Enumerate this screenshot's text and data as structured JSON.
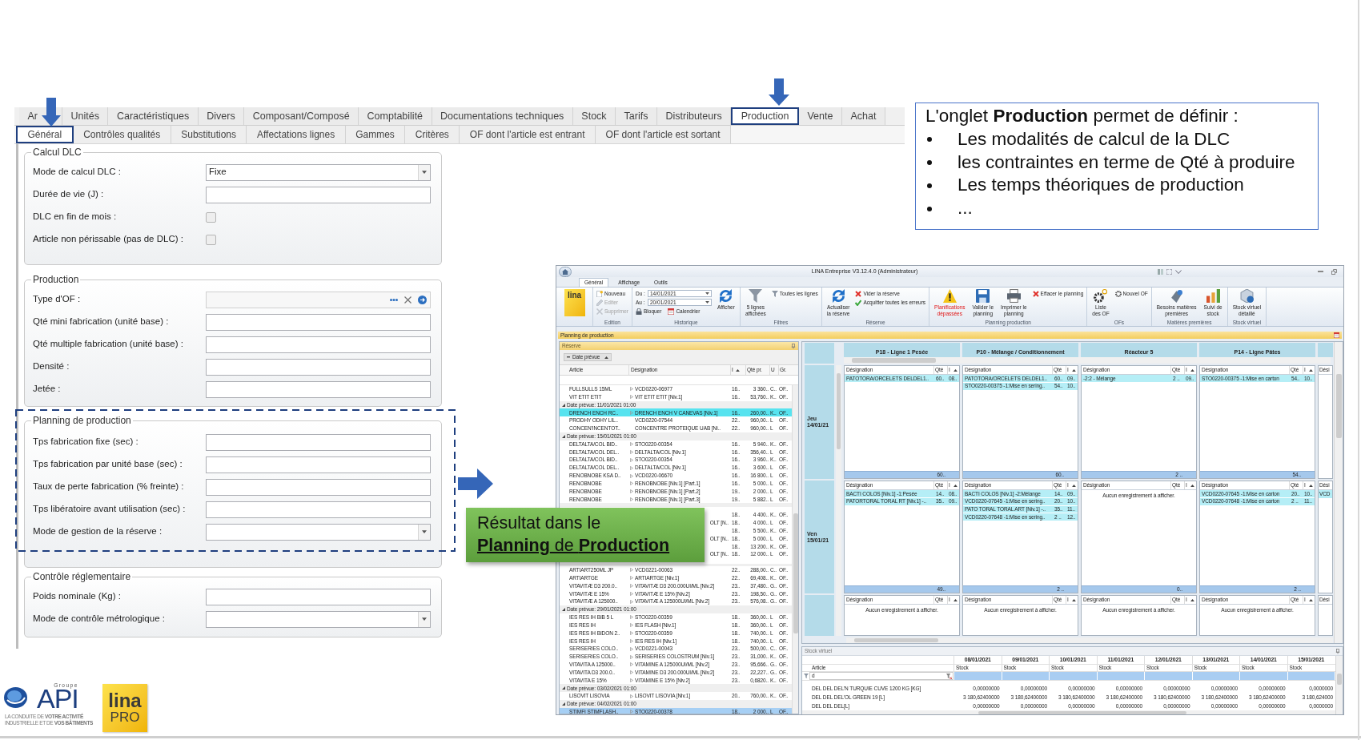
{
  "form": {
    "tabs": [
      {
        "label": "Ar",
        "selected": false
      },
      {
        "label": "Unités",
        "selected": false
      },
      {
        "label": "Caractéristiques",
        "selected": false
      },
      {
        "label": "Divers",
        "selected": false
      },
      {
        "label": "Composant/Composé",
        "selected": false
      },
      {
        "label": "Comptabilité",
        "selected": false
      },
      {
        "label": "Documentations techniques",
        "selected": false
      },
      {
        "label": "Stock",
        "selected": false
      },
      {
        "label": "Tarifs",
        "selected": false
      },
      {
        "label": "Distributeurs",
        "selected": false
      },
      {
        "label": "Production",
        "selected": true
      },
      {
        "label": "Vente",
        "selected": false
      },
      {
        "label": "Achat",
        "selected": false
      }
    ],
    "subtabs": [
      {
        "label": "Général",
        "selected": true
      },
      {
        "label": "Contrôles qualités",
        "selected": false
      },
      {
        "label": "Substitutions",
        "selected": false
      },
      {
        "label": "Affectations lignes",
        "selected": false
      },
      {
        "label": "Gammes",
        "selected": false
      },
      {
        "label": "Critères",
        "selected": false
      },
      {
        "label": "OF dont l'article est entrant",
        "selected": false
      },
      {
        "label": "OF dont l'article est sortant",
        "selected": false
      }
    ],
    "groups": [
      {
        "title": "Calcul DLC",
        "highlighted": false,
        "fields": [
          {
            "kind": "select",
            "label": "Mode de calcul DLC :",
            "value": "Fixe"
          },
          {
            "kind": "text",
            "label": "Durée de vie (J) :"
          },
          {
            "kind": "checkbox",
            "label": "DLC en fin de mois :",
            "checked": false
          },
          {
            "kind": "checkbox",
            "label": "Article non périssable (pas de DLC) :",
            "checked": false
          }
        ]
      },
      {
        "title": "Production",
        "highlighted": false,
        "fields": [
          {
            "kind": "lookup",
            "label": "Type d'OF :"
          },
          {
            "kind": "text",
            "label": "Qté mini fabrication (unité base) :"
          },
          {
            "kind": "text",
            "label": "Qté multiple fabrication (unité base) :"
          },
          {
            "kind": "text",
            "label": "Densité :"
          },
          {
            "kind": "text",
            "label": "Jetée :"
          }
        ]
      },
      {
        "title": "Planning de production",
        "highlighted": true,
        "fields": [
          {
            "kind": "text",
            "label": "Tps fabrication fixe (sec) :"
          },
          {
            "kind": "text",
            "label": "Tps fabrication par unité base (sec) :"
          },
          {
            "kind": "text",
            "label": "Taux de perte fabrication (% freinte) :"
          },
          {
            "kind": "text",
            "label": "Tps libératoire avant utilisation (sec) :"
          },
          {
            "kind": "select",
            "label": "Mode de gestion de la réserve :"
          }
        ]
      },
      {
        "title": "Contrôle réglementaire",
        "highlighted": false,
        "fields": [
          {
            "kind": "text",
            "label": "Poids nominale (Kg) :"
          },
          {
            "kind": "select",
            "label": "Mode de contrôle métrologique :"
          }
        ]
      }
    ]
  },
  "note": {
    "title": "L'onglet **Production** permet de définir :",
    "bullets": [
      "Les modalités de calcul de la DLC",
      "les contraintes en terme de Qté à produire",
      "Les temps théoriques de production",
      "..."
    ]
  },
  "callout": {
    "lead": "Résultat dans le",
    "emphasis": "**Planning** de **Production**"
  },
  "app": {
    "title": "LINA Entreprise V3.12.4.0 (Administrateur)",
    "ribbon_tabs": [
      {
        "label": "Général",
        "selected": true
      },
      {
        "label": "Affichage",
        "selected": false
      },
      {
        "label": "Outils",
        "selected": false
      }
    ],
    "ribbon_logo": "lina",
    "ribbon": [
      {
        "label": "Edition",
        "buttons": [
          {
            "kind": "small",
            "label": "Nouveau",
            "disabled": false
          },
          {
            "kind": "small",
            "label": "Editer",
            "disabled": true
          },
          {
            "kind": "small",
            "label": "Supprimer",
            "disabled": true
          }
        ]
      },
      {
        "label": "Historique",
        "buttons": [
          {
            "kind": "date",
            "label": "Du :",
            "value": "14/01/2021"
          },
          {
            "kind": "date",
            "label": "Au :",
            "value": "20/01/2021"
          },
          {
            "kind": "pair",
            "buttons": [
              {
                "kind": "small",
                "label": "Bloquer",
                "disabled": false
              },
              {
                "kind": "small",
                "label": "Calendrier",
                "disabled": false
              }
            ]
          },
          {
            "kind": "large",
            "label": "Afficher",
            "alert": false
          }
        ]
      },
      {
        "label": "Filtres",
        "buttons": [
          {
            "kind": "large",
            "label": "5 lignes\naffichées",
            "alert": false
          },
          {
            "kind": "small",
            "label": "Toutes les lignes",
            "disabled": false
          }
        ]
      },
      {
        "label": "Réserve",
        "buttons": [
          {
            "kind": "large",
            "label": "Actualiser\nla réserve",
            "alert": false
          },
          {
            "kind": "small",
            "label": "Vider la réserve",
            "disabled": false
          },
          {
            "kind": "small",
            "label": "Acquitter toutes les erreurs",
            "disabled": false
          }
        ]
      },
      {
        "label": "Planning production",
        "buttons": [
          {
            "kind": "large",
            "label": "Planifications\ndépassées",
            "alert": true
          },
          {
            "kind": "large",
            "label": "Valider le\nplanning",
            "alert": false
          },
          {
            "kind": "large",
            "label": "Imprimer le\nplanning",
            "alert": false
          },
          {
            "kind": "small",
            "label": "Effacer le planning",
            "disabled": false
          }
        ]
      },
      {
        "label": "OFs",
        "buttons": [
          {
            "kind": "large",
            "label": "Liste\ndes OF",
            "alert": false
          },
          {
            "kind": "small",
            "label": "Nouvel OF",
            "disabled": false
          }
        ]
      },
      {
        "label": "Matières premières",
        "buttons": [
          {
            "kind": "large",
            "label": "Besoins matières\npremières",
            "alert": false
          },
          {
            "kind": "large",
            "label": "Suivi de\nstock",
            "alert": false
          }
        ]
      },
      {
        "label": "Stock virtuel",
        "buttons": [
          {
            "kind": "large",
            "label": "Stock virtuel\ndétaillé",
            "alert": false
          }
        ]
      }
    ],
    "panel_title": "Planning de production",
    "reserve": {
      "title": "Réserve",
      "group_chip": "Date prévue",
      "columns": [
        "Article",
        "Désignation",
        "I",
        "Qté pr.",
        "U",
        "Gr."
      ],
      "rows": [
        {
          "kind": "row",
          "marked": true,
          "selected": false,
          "cells": [
            "FULLSULLS 15ML",
            "VCD0220-06977",
            "16..",
            "3 360..",
            "C..",
            "OF.."
          ]
        },
        {
          "kind": "row",
          "marked": true,
          "selected": false,
          "cells": [
            "VIT ETIT ETIT",
            "VIT ETIT ETIT [Niv.1]",
            "16..",
            "53,760..",
            "K..",
            "OF.."
          ]
        },
        {
          "kind": "group",
          "expanded": true,
          "label": "Date prévue: 11/01/2021 01:00"
        },
        {
          "kind": "row",
          "marked": true,
          "selected": true,
          "color": "#57e3ef",
          "cells": [
            "DRENCH ENCH RC..",
            "DRENCH ENCH V CANEVAS [Niv.1]",
            "16..",
            "260,00..",
            "K..",
            "OF.."
          ]
        },
        {
          "kind": "row",
          "marked": false,
          "selected": false,
          "cells": [
            "PRODHY ODHY LIL..",
            "VCD0220-07544",
            "22..",
            "960,00..",
            "L",
            "OF.."
          ]
        },
        {
          "kind": "row",
          "marked": false,
          "selected": false,
          "cells": [
            "CONCEN'INCENTOT..",
            "CONCENTRE PROTEIQUE UAB [Ni..",
            "22..",
            "960,00..",
            "L",
            "OF.."
          ]
        },
        {
          "kind": "group",
          "expanded": true,
          "label": "Date prévue: 15/01/2021 01:00"
        },
        {
          "kind": "row",
          "marked": true,
          "selected": false,
          "cells": [
            "DELTALTA/COL BID..",
            "STO0220-00354",
            "16..",
            "5 940..",
            "K..",
            "OF.."
          ]
        },
        {
          "kind": "row",
          "marked": true,
          "selected": false,
          "cells": [
            "DELTALTA/COL DEL..",
            "DELTALTA/COL [Niv.1]",
            "16..",
            "356,40..",
            "L",
            "OF.."
          ]
        },
        {
          "kind": "row",
          "marked": true,
          "selected": false,
          "cells": [
            "DELTALTA/COL BID..",
            "STO0220-00354",
            "16..",
            "3 960..",
            "K..",
            "OF.."
          ]
        },
        {
          "kind": "row",
          "marked": true,
          "selected": false,
          "cells": [
            "DELTALTA/COL DEL..",
            "DELTALTA/COL [Niv.1]",
            "16..",
            "3 600..",
            "L",
            "OF.."
          ]
        },
        {
          "kind": "row",
          "marked": true,
          "selected": false,
          "cells": [
            "RENOBNOBE KSA D..",
            "VCD0220-06670",
            "16..",
            "16 800..",
            "L",
            "OF.."
          ]
        },
        {
          "kind": "row",
          "marked": true,
          "selected": false,
          "cells": [
            "RENOBNOBE",
            "RENOBNOBE [Niv.1] [Part.1]",
            "16..",
            "5 000..",
            "L",
            "OF.."
          ]
        },
        {
          "kind": "row",
          "marked": true,
          "selected": false,
          "cells": [
            "RENOBNOBE",
            "RENOBNOBE [Niv.1] [Part.2]",
            "19..",
            "2 000..",
            "L",
            "OF.."
          ]
        },
        {
          "kind": "row",
          "marked": true,
          "selected": false,
          "cells": [
            "RENOBNOBE",
            "RENOBNOBE [Niv.1] [Part.3]",
            "19..",
            "5 882..",
            "L",
            "OF.."
          ]
        },
        {
          "kind": "covered-group"
        },
        {
          "kind": "covered",
          "cells": [
            "18..",
            "4 400..",
            "K..",
            "OF.."
          ]
        },
        {
          "kind": "covered",
          "designation_end": "OLT [N..",
          "cells": [
            "18..",
            "4 000..",
            "L",
            "OF.."
          ]
        },
        {
          "kind": "covered",
          "cells": [
            "18..",
            "5 500..",
            "K..",
            "OF.."
          ]
        },
        {
          "kind": "covered",
          "designation_end": "OLT [N..",
          "cells": [
            "18..",
            "5 000..",
            "L",
            "OF.."
          ]
        },
        {
          "kind": "covered",
          "cells": [
            "18..",
            "13 200..",
            "K..",
            "OF.."
          ]
        },
        {
          "kind": "covered",
          "designation_end": "OLT [N..",
          "cells": [
            "18..",
            "12 000..",
            "L",
            "OF.."
          ]
        },
        {
          "kind": "covered-group"
        },
        {
          "kind": "row",
          "marked": true,
          "selected": false,
          "cells": [
            "ARTIART250ML JP",
            "VCD0221-00063",
            "22..",
            "288,00..",
            "C..",
            "OF.."
          ]
        },
        {
          "kind": "row",
          "marked": true,
          "selected": false,
          "cells": [
            "ARTIARTGE",
            "ARTIARTGE [Niv.1]",
            "22..",
            "69,408..",
            "K..",
            "OF.."
          ]
        },
        {
          "kind": "row",
          "marked": true,
          "selected": false,
          "cells": [
            "VITAVITÆ D3 200.0..",
            "VITAVITÆ D3 200.000UI/ML [Niv.2]",
            "23..",
            "37,480..",
            "G..",
            "OF.."
          ]
        },
        {
          "kind": "row",
          "marked": true,
          "selected": false,
          "cells": [
            "VITAVITÆ E 15%",
            "VITAVITÆ E 15% [Niv.2]",
            "23..",
            "198,50..",
            "G..",
            "OF.."
          ]
        },
        {
          "kind": "row",
          "marked": true,
          "selected": false,
          "cells": [
            "VITAVITÆ A 125000..",
            "VITAVITÆ A 125000UI/ML [Niv.2]",
            "23..",
            "576,08..",
            "G..",
            "OF.."
          ]
        },
        {
          "kind": "group",
          "expanded": true,
          "label": "Date prévue: 29/01/2021 01:00"
        },
        {
          "kind": "row",
          "marked": true,
          "selected": false,
          "cells": [
            "IES RES IH BIB 5 L",
            "STO0220-00359",
            "18..",
            "360,00..",
            "L",
            "OF.."
          ]
        },
        {
          "kind": "row",
          "marked": true,
          "selected": false,
          "cells": [
            "IES RES IH",
            "IES FLASH [Niv.1]",
            "18..",
            "360,00..",
            "L",
            "OF.."
          ]
        },
        {
          "kind": "row",
          "marked": true,
          "selected": false,
          "cells": [
            "IES RES IH BIDON 2..",
            "STO0220-00359",
            "18..",
            "740,00..",
            "L",
            "OF.."
          ]
        },
        {
          "kind": "row",
          "marked": true,
          "selected": false,
          "cells": [
            "IES RES IH",
            "IES RES IH [Niv.1]",
            "18..",
            "740,00..",
            "L",
            "OF.."
          ]
        },
        {
          "kind": "row",
          "marked": true,
          "selected": false,
          "cells": [
            "SERISERIES COLO..",
            "VCD0221-00043",
            "23..",
            "500,00..",
            "C..",
            "OF.."
          ]
        },
        {
          "kind": "row",
          "marked": true,
          "selected": false,
          "cells": [
            "SERISERIES COLO..",
            "SERISERIES COLOSTRUM [Niv.1]",
            "23..",
            "31,000..",
            "K..",
            "OF.."
          ]
        },
        {
          "kind": "row",
          "marked": true,
          "selected": false,
          "cells": [
            "VITAVITA A 125000..",
            "VITAMINE A 125000UI/ML [Niv.2]",
            "23..",
            "95,666..",
            "G..",
            "OF.."
          ]
        },
        {
          "kind": "row",
          "marked": true,
          "selected": false,
          "cells": [
            "VITAVITA D3 200.0..",
            "VITAMINE D3 200.000UI/ML [Niv.2]",
            "23..",
            "22,227..",
            "G..",
            "OF.."
          ]
        },
        {
          "kind": "row",
          "marked": true,
          "selected": false,
          "cells": [
            "VITAVITA E 15%",
            "VITAMINE E 15% [Niv.2]",
            "23..",
            "0,6820..",
            "K..",
            "OF.."
          ]
        },
        {
          "kind": "group",
          "expanded": true,
          "label": "Date prévue: 03/02/2021 01:00"
        },
        {
          "kind": "row",
          "marked": true,
          "selected": false,
          "cells": [
            "LISOVIT LISOVIA",
            "LISOVIT LISOVIA [Niv.1]",
            "20..",
            "760,00..",
            "K..",
            "OF.."
          ]
        },
        {
          "kind": "group",
          "expanded": true,
          "label": "Date prévue: 04/02/2021 01:00"
        },
        {
          "kind": "row",
          "marked": true,
          "selected": true,
          "color": "#a6cff4",
          "cells": [
            "STIMFI STIMFLASH..",
            "STO0220-00378",
            "18..",
            "2 000..",
            "L",
            "OF.."
          ]
        }
      ]
    },
    "planning": {
      "resources": [
        "P18 - Ligne 1 Pesée",
        "P10 - Mélange / Conditionnement",
        "Réacteur 5",
        "P14 - Ligne Pâtes"
      ],
      "days": [
        {
          "label": "Jeu\n14/01/21",
          "cells": [
            {
              "kind": "grid",
              "columns": [
                "Désignation",
                "Qté",
                "I"
              ],
              "rows": [
                [
                  "PATOTORA/ORCELETS DELDEL1..",
                  "60..",
                  "08.."
                ]
              ],
              "total": "60.."
            },
            {
              "kind": "grid",
              "columns": [
                "Désignation",
                "Qté",
                "I"
              ],
              "rows": [
                [
                  "PATOTORA/ORCELETS DELDEL1..",
                  "60..",
                  "09.."
                ],
                [
                  "STO0220-00375 -1:Mise en sering..",
                  "54..",
                  "10.."
                ]
              ],
              "total": "60.."
            },
            {
              "kind": "grid",
              "columns": [
                "Désignation",
                "Qté",
                "I"
              ],
              "rows": [
                [
                  "-2:2 - Mélange",
                  "2 ..",
                  "09.."
                ]
              ],
              "total": "2 .."
            },
            {
              "kind": "grid",
              "columns": [
                "Désignation",
                "Qté",
                "I"
              ],
              "rows": [
                [
                  "STO0220-00375 -1:Mise en carton",
                  "54..",
                  "10.."
                ]
              ],
              "total": "54.."
            },
            {
              "kind": "partial",
              "column": "Dési"
            }
          ]
        },
        {
          "label": "Ven\n15/01/21",
          "cells": [
            {
              "kind": "grid",
              "columns": [
                "Désignation",
                "Qté",
                "I"
              ],
              "rows": [
                [
                  "BACTI COLOS [Niv.1] -1:Pesée",
                  "14..",
                  "08.."
                ],
                [
                  "PATORTORAL TORAL RT [Niv.1] -..",
                  "35..",
                  "09.."
                ]
              ],
              "total": "49.."
            },
            {
              "kind": "grid",
              "columns": [
                "Désignation",
                "Qté",
                "I"
              ],
              "rows": [
                [
                  "BACTI COLOS [Niv.1] -2:Mélange",
                  "14..",
                  "09.."
                ],
                [
                  "VCD0220-07645 -1:Mise en sering..",
                  "20..",
                  "10.."
                ],
                [
                  "PATO TORAL TORAL ART [Niv.1] -..",
                  "35..",
                  "11.."
                ],
                [
                  "VCD0220-07648 -1:Mise en sering..",
                  "2 ..",
                  "12.."
                ]
              ],
              "total": "2 .."
            },
            {
              "kind": "grid",
              "columns": [
                "Désignation",
                "Qté",
                "I"
              ],
              "empty_text": "Aucun enregistrement à afficher.",
              "total": "0.."
            },
            {
              "kind": "grid",
              "columns": [
                "Désignation",
                "Qté",
                "I"
              ],
              "rows": [
                [
                  "VCD0220-07645 -1:Mise en carton",
                  "20..",
                  "10.."
                ],
                [
                  "VCD0220-07648 -1:Mise en carton",
                  "2 ..",
                  "11.."
                ]
              ],
              "total": "2 .."
            },
            {
              "kind": "partial",
              "column": "Dési",
              "rows": [
                "VCD"
              ]
            }
          ]
        },
        {
          "cells": [
            {
              "kind": "grid",
              "columns": [
                "Désignation",
                "Qté",
                "I"
              ],
              "empty_text": "Aucun enregistrement à afficher."
            },
            {
              "kind": "grid",
              "columns": [
                "Désignation",
                "Qté",
                "I"
              ],
              "empty_text": "Aucun enregistrement à afficher."
            },
            {
              "kind": "grid",
              "columns": [
                "Désignation",
                "Qté",
                "I"
              ],
              "empty_text": "Aucun enregistrement à afficher."
            },
            {
              "kind": "grid",
              "columns": [
                "Désignation",
                "Qté",
                "I"
              ],
              "empty_text": "Aucun enregistrement à afficher."
            },
            {
              "kind": "partial",
              "column": "Dési"
            }
          ]
        }
      ]
    },
    "stock": {
      "title": "Stock virtuel",
      "first_column": "Article",
      "dates": [
        "08/01/2021",
        "09/01/2021",
        "10/01/2021",
        "11/01/2021",
        "12/01/2021",
        "13/01/2021",
        "14/01/2021",
        "15/01/2021"
      ],
      "subheaders": [
        "Stock",
        "Stock",
        "Stock",
        "Stock",
        "Stock",
        "Stock",
        "Stock",
        "Stock"
      ],
      "filter": "d",
      "rows": [
        {
          "article": "DEL DEL DEL'N TURQUIE CUVE 1200 KG [KG]",
          "values": [
            "0,00000000",
            "0,00000000",
            "0,00000000",
            "0,00000000",
            "0,00000000",
            "0,00000000",
            "0,00000000",
            "0,0000000"
          ]
        },
        {
          "article": "DEL DEL DEL'OL GREEN 19 [L]",
          "values": [
            "3 180,62400000",
            "3 180,62400000",
            "3 180,62400000",
            "3 180,62400000",
            "3 180,62400000",
            "3 180,62400000",
            "3 180,62400000",
            "3 180,624000"
          ]
        },
        {
          "article": "DEL DEL DEL[L]",
          "values": [
            "0,00000000",
            "0,00000000",
            "0,00000000",
            "0,00000000",
            "0,00000000",
            "0,00000000",
            "0,00000000",
            "0,0000000"
          ]
        }
      ]
    }
  },
  "logos": {
    "group_label": "Groupe",
    "brand": "API",
    "tagline": "LA CONDUITE DE **VOTRE ACTIVITÉ**\nINDUSTRIELLE ET DE **VOS BÂTIMENTS**",
    "product": "lina",
    "product_edition": "PRO"
  }
}
